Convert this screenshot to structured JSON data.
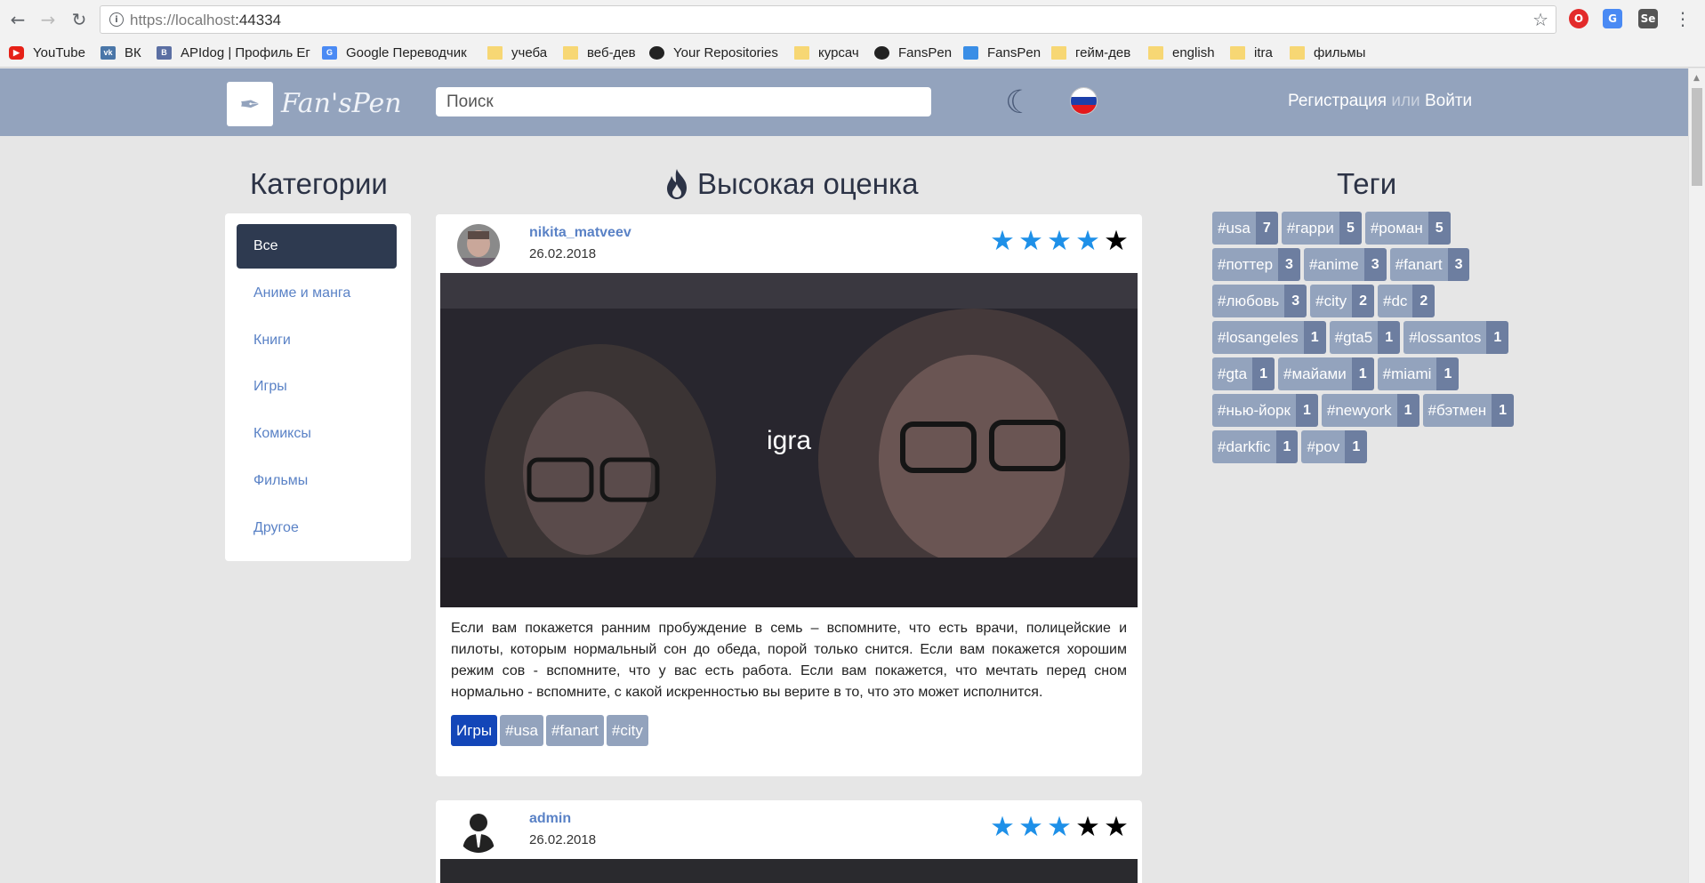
{
  "browser": {
    "url_main": "https://localhost",
    "url_port": ":44334",
    "bookmarks": [
      {
        "label": "YouTube",
        "icon": "youtube-icon"
      },
      {
        "label": "ВК",
        "icon": "vk-icon"
      },
      {
        "label": "APIdog | Профиль Ег",
        "icon": "apidog-icon"
      },
      {
        "label": "Google Переводчик",
        "icon": "google-translate-icon"
      },
      {
        "label": "учеба",
        "icon": "folder-icon"
      },
      {
        "label": "веб-дев",
        "icon": "folder-icon"
      },
      {
        "label": "Your Repositories",
        "icon": "github-icon"
      },
      {
        "label": "курсач",
        "icon": "folder-icon"
      },
      {
        "label": "FansPen",
        "icon": "github-icon"
      },
      {
        "label": "FansPen",
        "icon": "fanspen-icon"
      },
      {
        "label": "гейм-дев",
        "icon": "folder-icon"
      },
      {
        "label": "english",
        "icon": "folder-icon"
      },
      {
        "label": "itra",
        "icon": "folder-icon"
      },
      {
        "label": "фильмы",
        "icon": "folder-icon"
      }
    ]
  },
  "header": {
    "logo_text": "Fan'sPen",
    "search_placeholder": "Поиск",
    "register": "Регистрация",
    "or": "или",
    "login": "Войти"
  },
  "categories": {
    "title": "Категории",
    "items": [
      "Все",
      "Аниме и манга",
      "Книги",
      "Игры",
      "Комиксы",
      "Фильмы",
      "Другое"
    ],
    "active_index": 0
  },
  "feed": {
    "title": "Высокая оценка",
    "posts": [
      {
        "author": "nikita_matveev",
        "date": "26.02.2018",
        "rating": 4,
        "max_rating": 5,
        "image_title": "igra",
        "text": "Если вам покажется ранним пробуждение в семь – вспомните, что есть врачи, полицейские и пилоты, которым нормальный сон до обеда, порой только снится. Если вам покажется хорошим режим сов - вспомните, что у вас есть работа. Если вам покажется, что мечтать перед сном нормально - вспомните, с какой искренностью вы верите в то, что это может исполнится.",
        "category": "Игры",
        "tags": [
          "#usa",
          "#fanart",
          "#city"
        ]
      },
      {
        "author": "admin",
        "date": "26.02.2018",
        "rating": 3,
        "max_rating": 5
      }
    ]
  },
  "tags": {
    "title": "Теги",
    "rows": [
      [
        {
          "name": "#usa",
          "count": "7"
        },
        {
          "name": "#гарри",
          "count": "5"
        },
        {
          "name": "#роман",
          "count": "5"
        }
      ],
      [
        {
          "name": "#поттер",
          "count": "3"
        },
        {
          "name": "#anime",
          "count": "3"
        },
        {
          "name": "#fanart",
          "count": "3"
        }
      ],
      [
        {
          "name": "#любовь",
          "count": "3"
        },
        {
          "name": "#city",
          "count": "2"
        },
        {
          "name": "#dc",
          "count": "2"
        }
      ],
      [
        {
          "name": "#losangeles",
          "count": "1"
        },
        {
          "name": "#gta5",
          "count": "1"
        },
        {
          "name": "#lossantos",
          "count": "1"
        }
      ],
      [
        {
          "name": "#gta",
          "count": "1"
        },
        {
          "name": "#майами",
          "count": "1"
        },
        {
          "name": "#miami",
          "count": "1"
        }
      ],
      [
        {
          "name": "#нью-йорк",
          "count": "1"
        },
        {
          "name": "#newyork",
          "count": "1"
        },
        {
          "name": "#бэтмен",
          "count": "1"
        }
      ],
      [
        {
          "name": "#darkfic",
          "count": "1"
        },
        {
          "name": "#pov",
          "count": "1"
        }
      ]
    ]
  }
}
